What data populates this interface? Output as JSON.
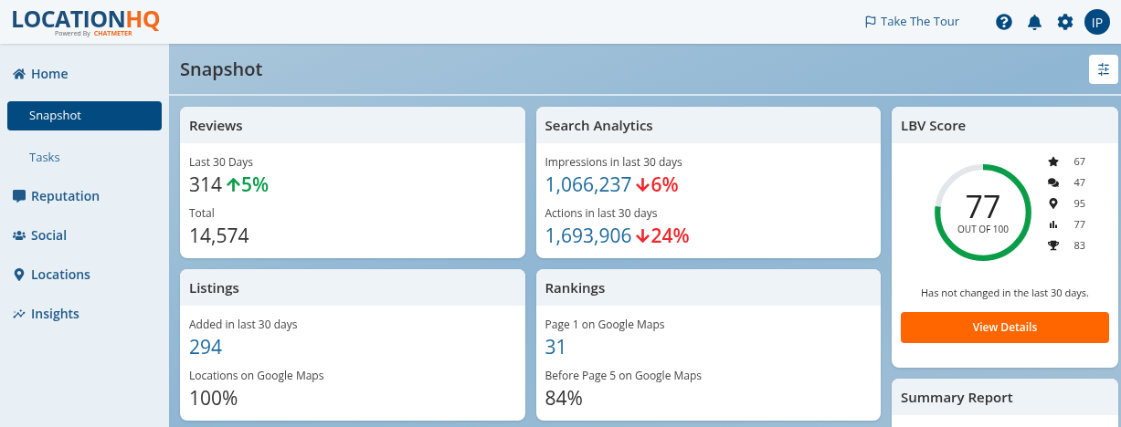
{
  "logo": {
    "name": "LOCATION",
    "suffix": "HQ",
    "tagline": "Powered By",
    "brand": "CHATMETER"
  },
  "header": {
    "tour": "Take The Tour",
    "avatar": "IP"
  },
  "sidebar": {
    "items": [
      {
        "label": "Home",
        "kind": "home",
        "selected": false,
        "children": [
          {
            "label": "Snapshot",
            "selected": true
          },
          {
            "label": "Tasks",
            "selected": false
          }
        ]
      },
      {
        "label": "Reputation",
        "kind": "message",
        "selected": false
      },
      {
        "label": "Social",
        "kind": "users",
        "selected": false
      },
      {
        "label": "Locations",
        "kind": "pin",
        "selected": false
      },
      {
        "label": "Insights",
        "kind": "chart",
        "selected": false
      }
    ]
  },
  "page": {
    "title": "Snapshot"
  },
  "cards": [
    {
      "title": "Reviews",
      "metrics": [
        {
          "label": "Last 30 Days",
          "value": "314",
          "highlighted": false,
          "delta": {
            "text": "5%",
            "kind": "up"
          }
        },
        {
          "label": "Total",
          "value": "14,574",
          "highlighted": false
        }
      ]
    },
    {
      "title": "Search Analytics",
      "metrics": [
        {
          "label": "Impressions in last 30 days",
          "value": "1,066,237",
          "highlighted": true,
          "delta": {
            "text": "6%",
            "kind": "down"
          }
        },
        {
          "label": "Actions in last 30 days",
          "value": "1,693,906",
          "highlighted": true,
          "delta": {
            "text": "24%",
            "kind": "down"
          }
        }
      ]
    },
    {
      "title": "Listings",
      "metrics": [
        {
          "label": "Added in last 30 days",
          "value": "294",
          "highlighted": true
        },
        {
          "label": "Locations on Google Maps",
          "value": "100%",
          "highlighted": false
        }
      ]
    },
    {
      "title": "Rankings",
      "metrics": [
        {
          "label": "Page 1 on Google Maps",
          "value": "31",
          "highlighted": true
        },
        {
          "label": "Before Page 5 on Google Maps",
          "value": "84%",
          "highlighted": false
        }
      ]
    }
  ],
  "lbv": {
    "title": "LBV Score",
    "score": "77",
    "out_of": "OUT OF 100",
    "level": 0.77,
    "breakdown": [
      {
        "kind": "star",
        "value": "67"
      },
      {
        "kind": "chat",
        "value": "47"
      },
      {
        "kind": "pin",
        "value": "95"
      },
      {
        "kind": "chart",
        "value": "77"
      },
      {
        "kind": "trophy",
        "value": "83"
      }
    ],
    "note": "Has not changed in the last 30 days.",
    "button": "View Details"
  },
  "summary": {
    "title": "Summary Report"
  }
}
